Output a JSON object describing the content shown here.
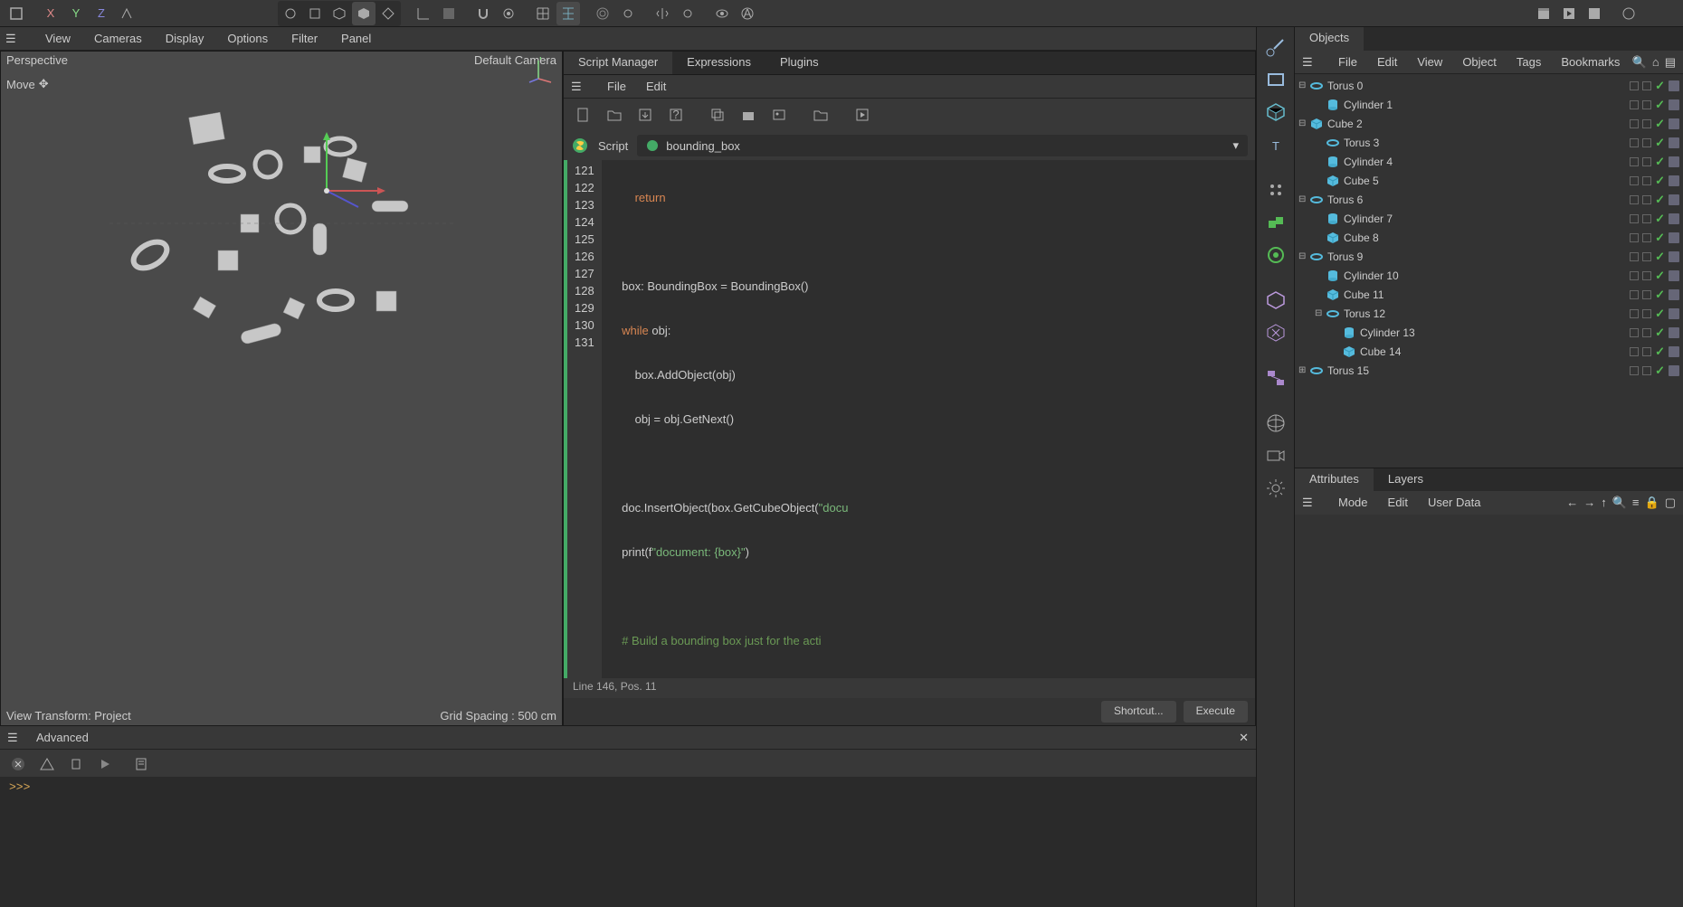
{
  "toolbar": {
    "axis_x": "X",
    "axis_y": "Y",
    "axis_z": "Z"
  },
  "viewport": {
    "menus": [
      "View",
      "Cameras",
      "Display",
      "Options",
      "Filter",
      "Panel"
    ],
    "title": "Perspective",
    "camera": "Default Camera",
    "tool": "Move",
    "transform": "View Transform: Project",
    "grid": "Grid Spacing : 500 cm"
  },
  "script": {
    "tabs": [
      "Script Manager",
      "Expressions",
      "Plugins"
    ],
    "menus": [
      "File",
      "Edit"
    ],
    "label": "Script",
    "name": "bounding_box",
    "lines": [
      121,
      122,
      123,
      124,
      125,
      126,
      127,
      128,
      129,
      130,
      131
    ],
    "status": "Line 146, Pos. 11",
    "btn_shortcut": "Shortcut...",
    "btn_execute": "Execute"
  },
  "code": {
    "l121": "        return",
    "l123a": "    box: BoundingBox = BoundingBox()",
    "l124a": "    ",
    "l124b": "while",
    "l124c": " obj:",
    "l125": "        box.AddObject(obj)",
    "l126": "        obj = obj.GetNext()",
    "l128a": "    doc.InsertObject(box.GetCubeObject(",
    "l128b": "\"docu",
    "l129a": "    print(f",
    "l129b": "\"document: {box}\"",
    "l129c": ")",
    "l131": "    # Build a bounding box just for the acti"
  },
  "console": {
    "title": "Advanced",
    "prompt": ">>>"
  },
  "objects": {
    "tab": "Objects",
    "menus": [
      "File",
      "Edit",
      "View",
      "Object",
      "Tags",
      "Bookmarks"
    ],
    "tree": [
      {
        "d": 0,
        "t": "torus",
        "n": "Torus 0",
        "e": "-"
      },
      {
        "d": 1,
        "t": "cylinder",
        "n": "Cylinder 1",
        "e": ""
      },
      {
        "d": 0,
        "t": "cube",
        "n": "Cube 2",
        "e": "-"
      },
      {
        "d": 1,
        "t": "torus",
        "n": "Torus 3",
        "e": ""
      },
      {
        "d": 1,
        "t": "cylinder",
        "n": "Cylinder 4",
        "e": ""
      },
      {
        "d": 1,
        "t": "cube",
        "n": "Cube 5",
        "e": ""
      },
      {
        "d": 0,
        "t": "torus",
        "n": "Torus 6",
        "e": "-"
      },
      {
        "d": 1,
        "t": "cylinder",
        "n": "Cylinder 7",
        "e": ""
      },
      {
        "d": 1,
        "t": "cube",
        "n": "Cube 8",
        "e": ""
      },
      {
        "d": 0,
        "t": "torus",
        "n": "Torus 9",
        "e": "-"
      },
      {
        "d": 1,
        "t": "cylinder",
        "n": "Cylinder 10",
        "e": ""
      },
      {
        "d": 1,
        "t": "cube",
        "n": "Cube 11",
        "e": ""
      },
      {
        "d": 1,
        "t": "torus",
        "n": "Torus 12",
        "e": "-"
      },
      {
        "d": 2,
        "t": "cylinder",
        "n": "Cylinder 13",
        "e": ""
      },
      {
        "d": 2,
        "t": "cube",
        "n": "Cube 14",
        "e": ""
      },
      {
        "d": 0,
        "t": "torus",
        "n": "Torus 15",
        "e": "+"
      }
    ]
  },
  "attributes": {
    "tabs": [
      "Attributes",
      "Layers"
    ],
    "menus": [
      "Mode",
      "Edit",
      "User Data"
    ]
  }
}
